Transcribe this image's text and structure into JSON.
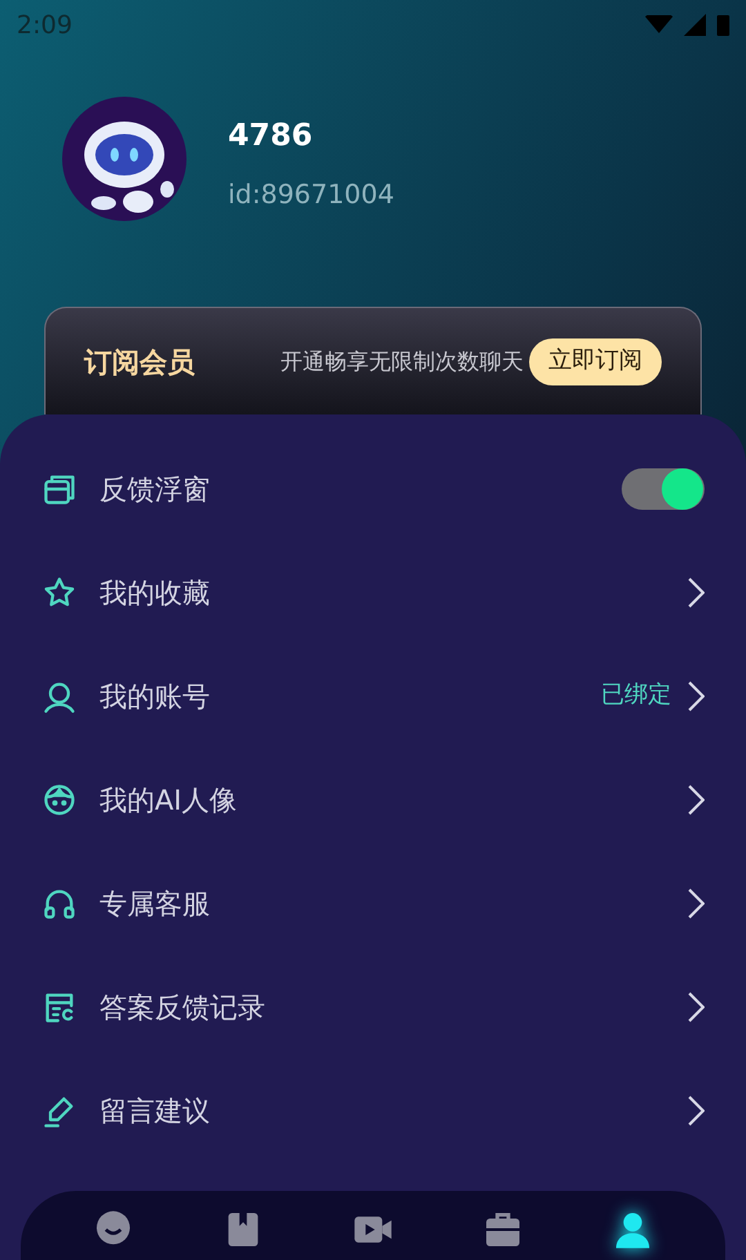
{
  "status_bar": {
    "time": "2:09"
  },
  "profile": {
    "name": "4786",
    "id": "id:89671004"
  },
  "membership": {
    "title": "订阅会员",
    "description": "开通畅享无限制次数聊天",
    "button": "立即订阅"
  },
  "menu": [
    {
      "kind": "toggle",
      "label": "反馈浮窗",
      "on": true
    },
    {
      "kind": "link",
      "label": "我的收藏"
    },
    {
      "kind": "link",
      "label": "我的账号",
      "value": "已绑定"
    },
    {
      "kind": "link",
      "label": "我的AI人像"
    },
    {
      "kind": "link",
      "label": "专属客服"
    },
    {
      "kind": "link",
      "label": "答案反馈记录"
    },
    {
      "kind": "link",
      "label": "留言建议"
    }
  ],
  "bottom_nav": [
    {
      "selected": false
    },
    {
      "selected": false
    },
    {
      "selected": false
    },
    {
      "selected": false
    },
    {
      "selected": true
    }
  ]
}
